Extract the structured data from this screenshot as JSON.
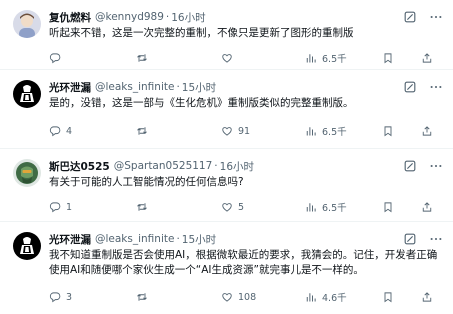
{
  "tweets": [
    {
      "name": "复仇燃料",
      "handle": "@kennyd989",
      "dot": "·",
      "time": "16小时",
      "text": "听起来不错，这是一次完整的重制，不像只是更新了图形的重制版",
      "replies": "",
      "retweets": "",
      "likes": "",
      "views": "6.5千"
    },
    {
      "name": "光环泄漏",
      "handle": "@leaks_infinite",
      "dot": "·",
      "time": "15小时",
      "text": "是的，没错，这是一部与《生化危机》重制版类似的完整重制版。",
      "replies": "4",
      "retweets": "",
      "likes": "91",
      "views": "6.5千"
    },
    {
      "name": "斯巴达0525",
      "handle": "@Spartan0525117",
      "dot": "·",
      "time": "16小时",
      "text": "有关于可能的人工智能情况的任何信息吗?",
      "replies": "1",
      "retweets": "",
      "likes": "5",
      "views": "6.5千"
    },
    {
      "name": "光环泄漏",
      "handle": "@leaks_infinite",
      "dot": "·",
      "time": "15小时",
      "text": "我不知道重制版是否会使用AI，根据微软最近的要求，我猜会的。记住，开发者正确使用AI和随便哪个家伙生成一个“AI生成资源”就完事儿是不一样的。",
      "replies": "3",
      "retweets": "",
      "likes": "108",
      "views": "4.6千"
    }
  ],
  "colors": {
    "text": "#0f1419",
    "muted": "#536471",
    "divider": "#eff3f4",
    "thread": "#cfd9de"
  },
  "icons": [
    "grok-icon",
    "more-icon",
    "reply-icon",
    "retweet-icon",
    "like-icon",
    "views-icon",
    "bookmark-icon",
    "share-icon"
  ]
}
